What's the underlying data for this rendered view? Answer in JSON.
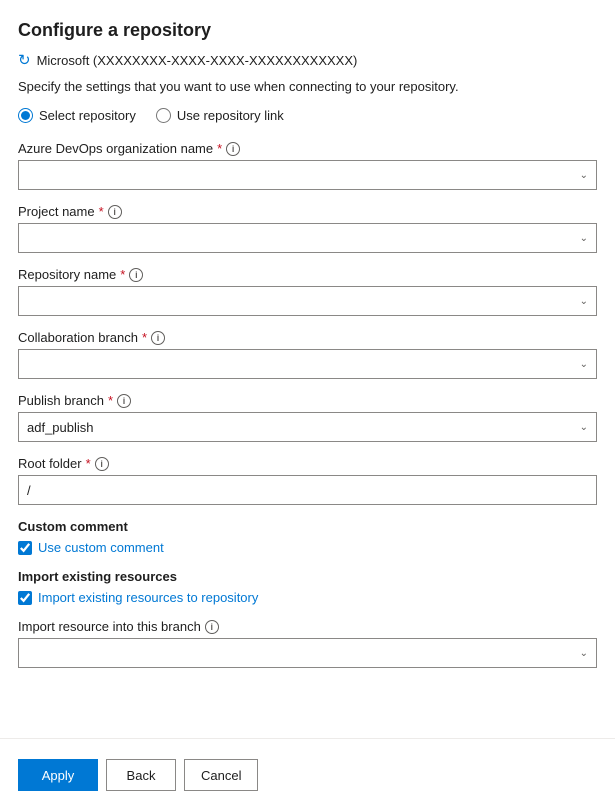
{
  "page": {
    "title": "Configure a repository",
    "account_icon": "↻",
    "account_label": "Microsoft (XXXXXXXX-XXXX-XXXX-XXXXXXXXXXXX)",
    "description": "Specify the settings that you want to use when connecting to your repository.",
    "radio_options": [
      {
        "id": "select-repo",
        "label": "Select repository",
        "checked": true
      },
      {
        "id": "use-link",
        "label": "Use repository link",
        "checked": false
      }
    ],
    "fields": [
      {
        "id": "azure-devops-org",
        "label": "Azure DevOps organization name",
        "required": true,
        "has_info": true,
        "type": "dropdown",
        "value": ""
      },
      {
        "id": "project-name",
        "label": "Project name",
        "required": true,
        "has_info": true,
        "type": "dropdown",
        "value": ""
      },
      {
        "id": "repository-name",
        "label": "Repository name",
        "required": true,
        "has_info": true,
        "type": "dropdown",
        "value": ""
      },
      {
        "id": "collaboration-branch",
        "label": "Collaboration branch",
        "required": true,
        "has_info": true,
        "type": "dropdown",
        "value": ""
      },
      {
        "id": "publish-branch",
        "label": "Publish branch",
        "required": true,
        "has_info": true,
        "type": "dropdown",
        "value": "adf_publish"
      },
      {
        "id": "root-folder",
        "label": "Root folder",
        "required": true,
        "has_info": true,
        "type": "text",
        "value": "/"
      }
    ],
    "checkboxes": [
      {
        "section": "Custom comment",
        "id": "use-custom-comment",
        "label": "Use custom comment",
        "checked": true
      },
      {
        "section": "Import existing resources",
        "id": "import-existing",
        "label": "Import existing resources to repository",
        "checked": true
      }
    ],
    "import_branch_field": {
      "id": "import-resource-branch",
      "label": "Import resource into this branch",
      "has_info": true,
      "type": "dropdown",
      "value": ""
    },
    "buttons": {
      "apply": "Apply",
      "back": "Back",
      "cancel": "Cancel"
    }
  }
}
